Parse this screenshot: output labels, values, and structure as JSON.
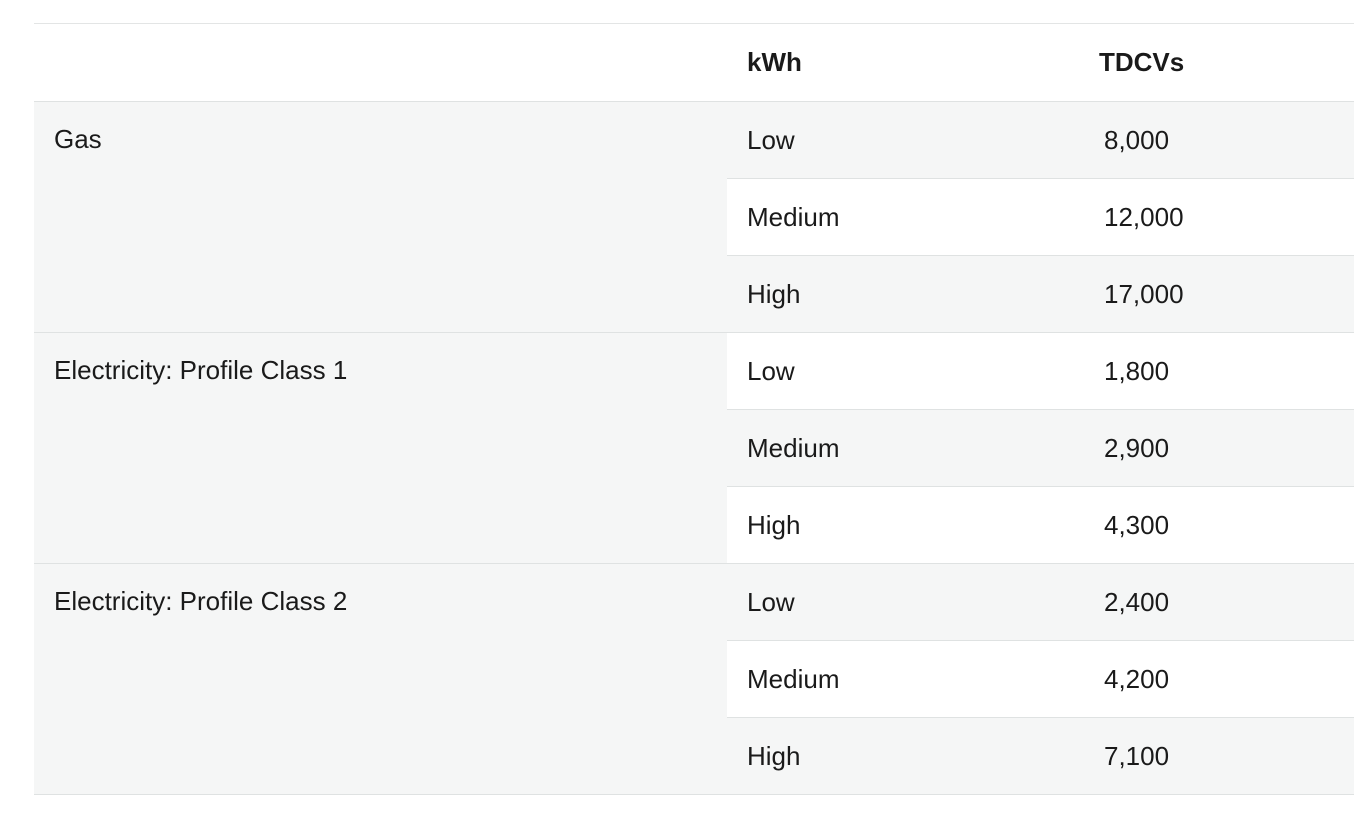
{
  "table": {
    "headers": {
      "blank": "",
      "kwh": "kWh",
      "tdcvs": "TDCVs"
    },
    "groups": [
      {
        "label": "Gas",
        "rows": [
          {
            "level": "Low",
            "value": "8,000"
          },
          {
            "level": "Medium",
            "value": "12,000"
          },
          {
            "level": "High",
            "value": "17,000"
          }
        ]
      },
      {
        "label": "Electricity: Profile Class 1",
        "rows": [
          {
            "level": "Low",
            "value": "1,800"
          },
          {
            "level": "Medium",
            "value": "2,900"
          },
          {
            "level": "High",
            "value": "4,300"
          }
        ]
      },
      {
        "label": "Electricity: Profile Class 2",
        "rows": [
          {
            "level": "Low",
            "value": "2,400"
          },
          {
            "level": "Medium",
            "value": "4,200"
          },
          {
            "level": "High",
            "value": "7,100"
          }
        ]
      }
    ]
  }
}
